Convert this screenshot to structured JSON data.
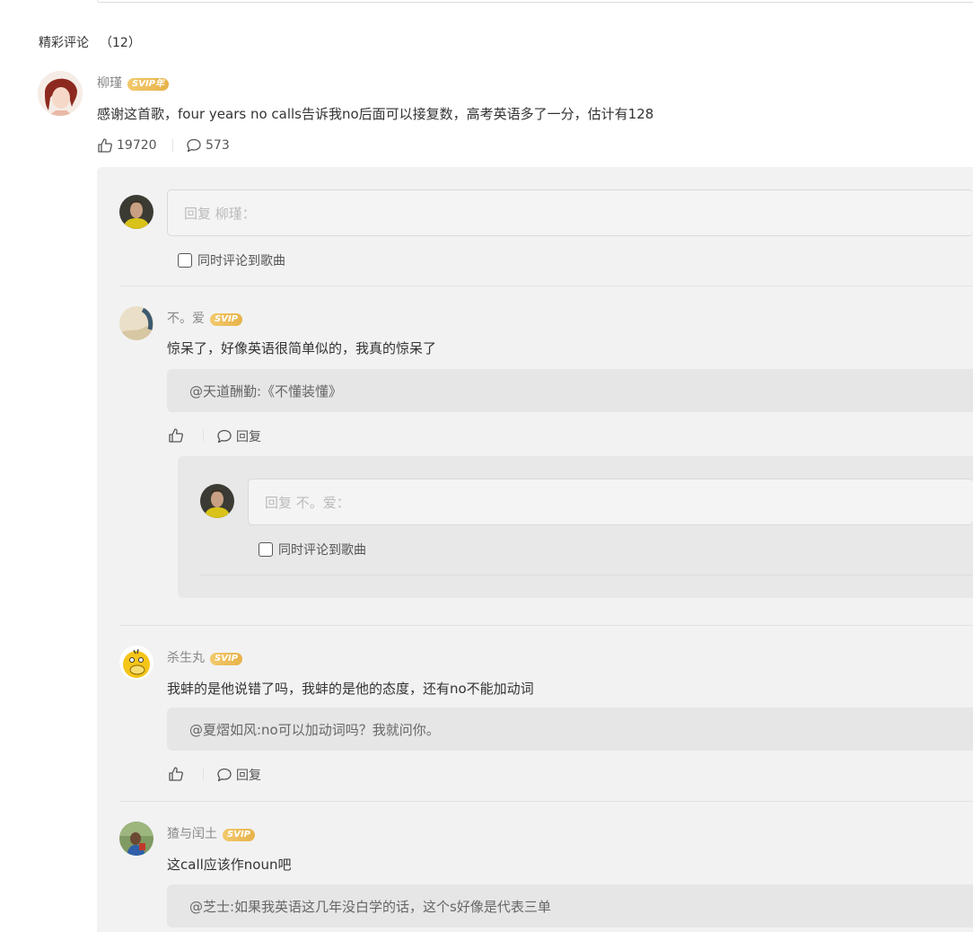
{
  "section": {
    "title": "精彩评论",
    "count": "（12）"
  },
  "main_comment": {
    "user": "柳瑾",
    "badge": "SVIP年",
    "text": "感谢这首歌，four years no calls告诉我no后面可以接复数，高考英语多了一分，估计有128",
    "likes": "19720",
    "replies": "573"
  },
  "reply_box": {
    "placeholder": "回复 柳瑾：",
    "checkbox_label": "同时评论到歌曲"
  },
  "replies": [
    {
      "user": "不。爱",
      "badge": "SVIP",
      "text": "惊呆了，好像英语很简单似的，我真的惊呆了",
      "quote": "@天道酬勤:《不懂装懂》",
      "reply_label": "回复",
      "nested_reply_box": {
        "placeholder": "回复 不。爱：",
        "checkbox_label": "同时评论到歌曲"
      }
    },
    {
      "user": "杀生丸",
      "badge": "SVIP",
      "text": "我蚌的是他说错了吗，我蚌的是他的态度，还有no不能加动词",
      "quote": "@夏熠如风:no可以加动词吗？我就问你。",
      "reply_label": "回复"
    },
    {
      "user": "猹与闰土",
      "badge": "SVIP",
      "text": "这call应该作noun吧",
      "quote": "@芝士:如果我英语这几年没白学的话，这个s好像是代表三单"
    }
  ],
  "colors": {
    "badge_gold": "#e7b24a",
    "panel_bg": "#f2f2f2",
    "quote_bg": "#e6e6e6"
  }
}
